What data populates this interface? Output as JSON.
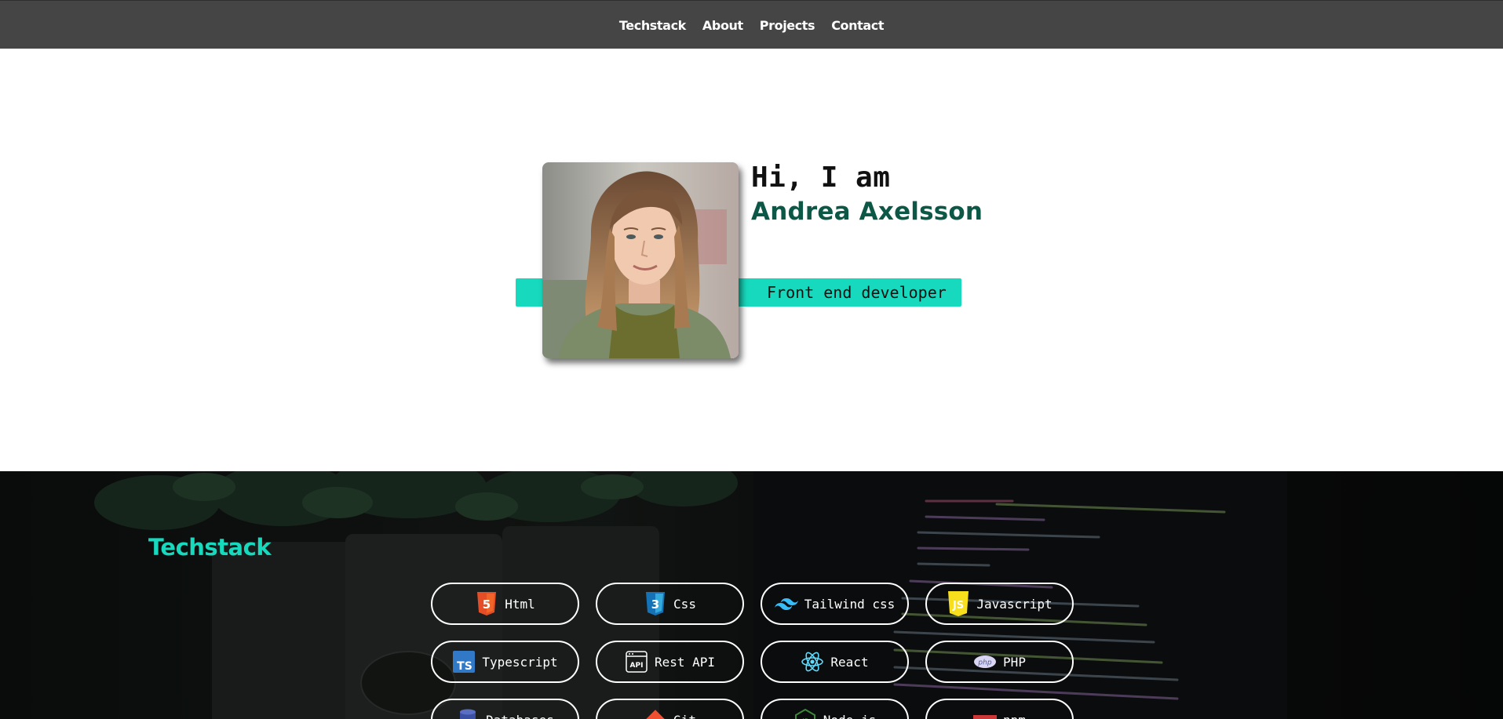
{
  "nav": {
    "items": [
      {
        "label": "Techstack"
      },
      {
        "label": "About"
      },
      {
        "label": "Projects"
      },
      {
        "label": "Contact"
      }
    ]
  },
  "hero": {
    "greeting": "Hi, I am",
    "name": "Andrea Axelsson",
    "role": "Front end developer"
  },
  "techstack": {
    "title": "Techstack",
    "items": [
      {
        "label": "Html",
        "icon": "html5-icon"
      },
      {
        "label": "Css",
        "icon": "css3-icon"
      },
      {
        "label": "Tailwind css",
        "icon": "tailwind-icon"
      },
      {
        "label": "Javascript",
        "icon": "javascript-icon"
      },
      {
        "label": "Typescript",
        "icon": "typescript-icon"
      },
      {
        "label": "Rest API",
        "icon": "api-icon"
      },
      {
        "label": "React",
        "icon": "react-icon"
      },
      {
        "label": "PHP",
        "icon": "php-icon"
      },
      {
        "label": "Databases",
        "icon": "database-icon"
      },
      {
        "label": "Git",
        "icon": "git-icon"
      },
      {
        "label": "Node.js",
        "icon": "nodejs-icon"
      },
      {
        "label": "npm",
        "icon": "npm-icon"
      }
    ]
  },
  "colors": {
    "nav_bg": "#454545",
    "accent_teal": "#17d9bd",
    "name_green": "#0c5746"
  }
}
